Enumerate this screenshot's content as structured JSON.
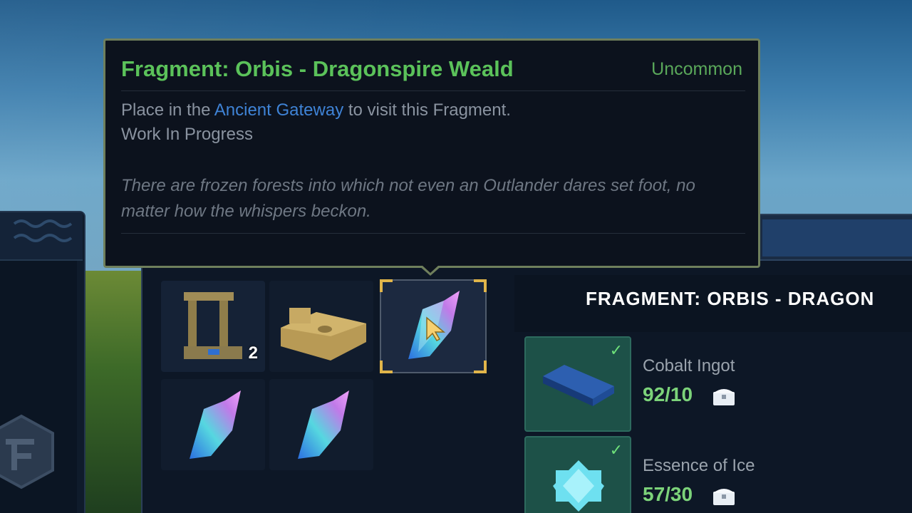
{
  "tooltip": {
    "title": "Fragment: Orbis - Dragonspire Weald",
    "rarity": "Uncommon",
    "desc_prefix": "Place in the ",
    "desc_link": "Ancient Gateway",
    "desc_suffix": " to visit this Fragment.",
    "status": "Work In Progress",
    "lore": "There are frozen forests into which not even an Outlander dares set foot, no matter how the whispers beckon."
  },
  "inventory": {
    "slots": [
      {
        "icon": "gateway-frame-icon",
        "count": "2"
      },
      {
        "icon": "stone-ruins-icon",
        "count": ""
      },
      {
        "icon": "fragment-crystal-icon",
        "count": "",
        "selected": true
      },
      {
        "icon": "fragment-crystal-icon",
        "count": ""
      },
      {
        "icon": "fragment-crystal-icon",
        "count": ""
      }
    ]
  },
  "detail": {
    "title": "FRAGMENT: ORBIS - DRAGON",
    "requirements": [
      {
        "name": "Cobalt Ingot",
        "qty": "92/10",
        "icon": "cobalt-ingot-icon",
        "met": true
      },
      {
        "name": "Essence of Ice",
        "qty": "57/30",
        "icon": "ice-essence-icon",
        "met": true
      }
    ]
  },
  "colors": {
    "title_green": "#5bc25a",
    "link_blue": "#3f83d6",
    "selection_gold": "#e1b54a",
    "req_met_bg": "#1d5148"
  }
}
